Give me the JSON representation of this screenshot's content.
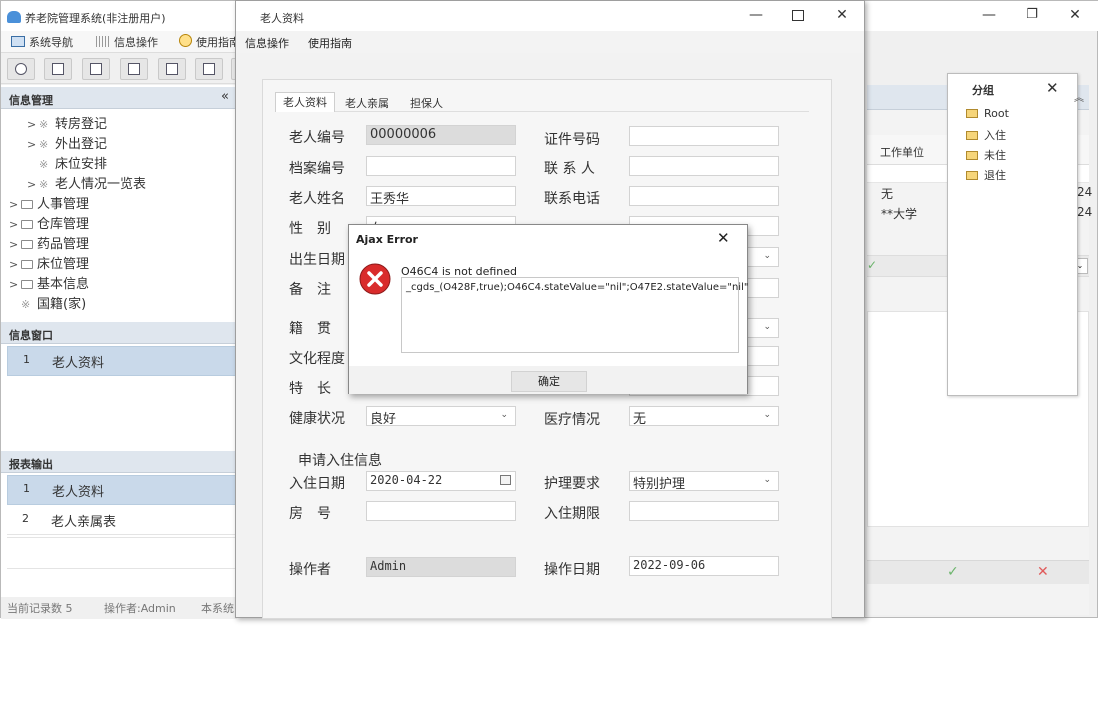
{
  "main": {
    "title": "养老院管理系统(非注册用户)",
    "menu": [
      "系统导航",
      "信息操作",
      "使用指南"
    ],
    "window_controls": {
      "minimize": "—",
      "restore": "❐",
      "close": "✕"
    }
  },
  "nav_panel": {
    "header": "信息管理",
    "collapse": "«",
    "tree": [
      {
        "label": "转房登记",
        "level": 1,
        "expandable": true
      },
      {
        "label": "外出登记",
        "level": 1,
        "expandable": true
      },
      {
        "label": "床位安排",
        "level": 1,
        "expandable": false
      },
      {
        "label": "老人情况一览表",
        "level": 1,
        "expandable": true
      },
      {
        "label": "人事管理",
        "level": 0,
        "expandable": true
      },
      {
        "label": "仓库管理",
        "level": 0,
        "expandable": true
      },
      {
        "label": "药品管理",
        "level": 0,
        "expandable": true
      },
      {
        "label": "床位管理",
        "level": 0,
        "expandable": true
      },
      {
        "label": "基本信息",
        "level": 0,
        "expandable": true
      },
      {
        "label": "国籍(家)",
        "level": 0,
        "expandable": false
      }
    ]
  },
  "info_window_panel": {
    "header": "信息窗口",
    "rows": [
      {
        "num": "1",
        "label": "老人资料"
      }
    ]
  },
  "report_panel": {
    "header": "报表输出",
    "rows": [
      {
        "num": "1",
        "label": "老人资料"
      },
      {
        "num": "2",
        "label": "老人亲属表"
      }
    ]
  },
  "statusbar": {
    "record_count": "当前记录数 5",
    "operator": "操作者:Admin",
    "system": "本系统"
  },
  "background_grid": {
    "column_header": "工作单位",
    "rows": [
      {
        "unit": "无",
        "tail": "24"
      },
      {
        "unit": "**大学",
        "tail": "24"
      }
    ],
    "confirm": "✓",
    "cancel": "✕"
  },
  "group_panel": {
    "title": "分组",
    "close": "✕",
    "items": [
      "Root",
      "入住",
      "未住",
      "退住"
    ]
  },
  "elder_window": {
    "title": "老人资料",
    "menu": [
      "信息操作",
      "使用指南"
    ],
    "tabs": [
      "老人资料",
      "老人亲属",
      "担保人"
    ],
    "fields": {
      "elder_no": {
        "label": "老人编号",
        "value": "00000006"
      },
      "id_no": {
        "label": "证件号码",
        "value": ""
      },
      "file_no": {
        "label": "档案编号",
        "value": ""
      },
      "contact": {
        "label": "联 系 人",
        "value": ""
      },
      "name": {
        "label": "老人姓名",
        "value": "王秀华"
      },
      "phone": {
        "label": "联系电话",
        "value": ""
      },
      "gender": {
        "label": "性　别",
        "value": "女"
      },
      "birth": {
        "label": "出生日期",
        "value": ""
      },
      "remark": {
        "label": "备　注",
        "value": ""
      },
      "native": {
        "label": "籍　贯",
        "value": ""
      },
      "education": {
        "label": "文化程度",
        "value": ""
      },
      "specialty": {
        "label": "特　长",
        "value": ""
      },
      "health": {
        "label": "健康状况",
        "value": "良好"
      },
      "medical": {
        "label": "医疗情况",
        "value": "无"
      },
      "checkin_date": {
        "label": "入住日期",
        "value": "2020-04-22"
      },
      "care_req": {
        "label": "护理要求",
        "value": "特别护理"
      },
      "room": {
        "label": "房　号",
        "value": ""
      },
      "period": {
        "label": "入住期限",
        "value": ""
      },
      "operator": {
        "label": "操作者",
        "value": "Admin"
      },
      "op_date": {
        "label": "操作日期",
        "value": "2022-09-06"
      }
    },
    "section_checkin": "申请入住信息"
  },
  "dialog": {
    "title": "Ajax Error",
    "close": "✕",
    "message": "O46C4 is not defined",
    "detail": "_cgds_(O428F,true);O46C4.stateValue=\"nil\";O47E2.stateValue=\"nil\"",
    "ok": "确定"
  }
}
